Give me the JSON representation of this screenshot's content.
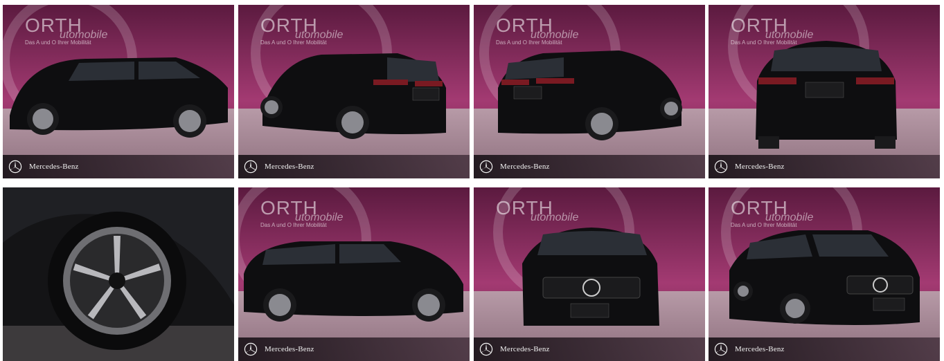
{
  "gallery": {
    "brand_name": "ORTH",
    "brand_sub": "utomobile",
    "brand_tagline": "Das A und O Ihrer Mobilität",
    "footer_label": "Mercedes-Benz",
    "plate_text": "ORTH",
    "plate_sub": "utomobile"
  },
  "colors": {
    "backdrop": "#8a2a5c",
    "floor": "#a98c98",
    "car": "#0e0e10",
    "footer": "#2a1e26"
  },
  "icons": {
    "footer": "mercedes-star-icon"
  }
}
